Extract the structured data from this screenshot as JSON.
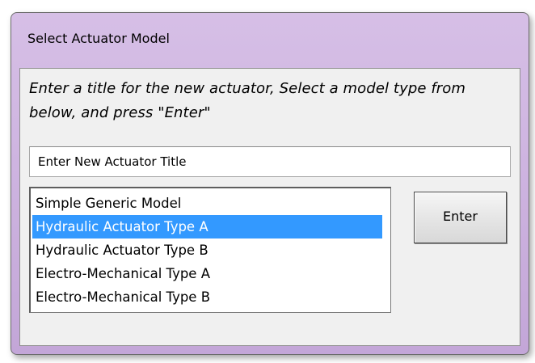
{
  "window": {
    "title": "Select Actuator Model"
  },
  "instructions": {
    "text": "Enter a title for the new actuator, Select a model type from below, and press \"Enter\""
  },
  "title_input": {
    "value": "Enter New Actuator Title"
  },
  "model_list": {
    "items": [
      {
        "label": "Simple Generic Model",
        "selected": false
      },
      {
        "label": "Hydraulic Actuator Type A",
        "selected": true
      },
      {
        "label": "Hydraulic Actuator Type B",
        "selected": false
      },
      {
        "label": "Electro-Mechanical Type A",
        "selected": false
      },
      {
        "label": "Electro-Mechanical Type B",
        "selected": false
      }
    ],
    "selected_index": 1
  },
  "buttons": {
    "enter_label": "Enter"
  },
  "colors": {
    "window_frame": "#cfb5e1",
    "selection": "#3399ff",
    "client_bg": "#f0f0f0"
  }
}
